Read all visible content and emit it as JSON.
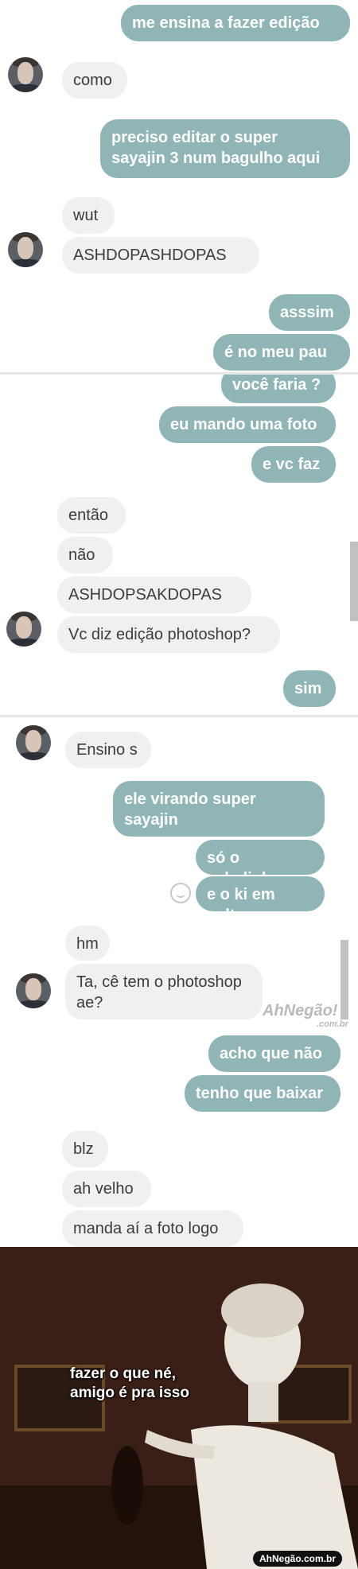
{
  "panel1": {
    "messages": [
      {
        "text": "me ensina a fazer edição",
        "side": "out"
      },
      {
        "text": "como",
        "side": "in"
      },
      {
        "text": "preciso editar o super\nsayajin 3 num bagulho aqui",
        "side": "out"
      },
      {
        "text": "wut",
        "side": "in"
      },
      {
        "text": "ASHDOPASHDOPAS",
        "side": "in"
      },
      {
        "text": "asssim",
        "side": "out"
      },
      {
        "text": "é no meu pau",
        "side": "out"
      }
    ]
  },
  "panel2": {
    "messages": [
      {
        "text": "você faria ?",
        "side": "out"
      },
      {
        "text": "eu mando uma foto",
        "side": "out"
      },
      {
        "text": "e vc faz",
        "side": "out"
      },
      {
        "text": "então",
        "side": "in"
      },
      {
        "text": "não",
        "side": "in"
      },
      {
        "text": "ASHDOPSAKDOPAS",
        "side": "in"
      },
      {
        "text": "Vc diz edição photoshop?",
        "side": "in"
      },
      {
        "text": "sim",
        "side": "out"
      }
    ]
  },
  "panel3": {
    "messages": [
      {
        "text": "Ensino s",
        "side": "in"
      },
      {
        "text": "ele virando super sayajin\nmano",
        "side": "out"
      },
      {
        "text": "só o cabelinho",
        "side": "out"
      },
      {
        "text": "e o ki em volta",
        "side": "out"
      },
      {
        "text": "hm",
        "side": "in"
      },
      {
        "text": "Ta, cê tem o photoshop\nae?",
        "side": "in"
      }
    ]
  },
  "panel4": {
    "messages": [
      {
        "text": "acho que não",
        "side": "out"
      },
      {
        "text": "tenho que baixar",
        "side": "out"
      },
      {
        "text": "blz",
        "side": "in"
      },
      {
        "text": "ah velho",
        "side": "in"
      },
      {
        "text": "manda aí a foto logo",
        "side": "in"
      }
    ]
  },
  "watermark": {
    "logo": "AhNegão!",
    "sub": ".com.br"
  },
  "meme": {
    "caption": "fazer o que né,\namigo é pra isso",
    "site_badge": "AhNegão.com.br"
  },
  "colors": {
    "outgoing_bubble": "#8fb5b7",
    "incoming_bubble": "#f0f0f0"
  }
}
